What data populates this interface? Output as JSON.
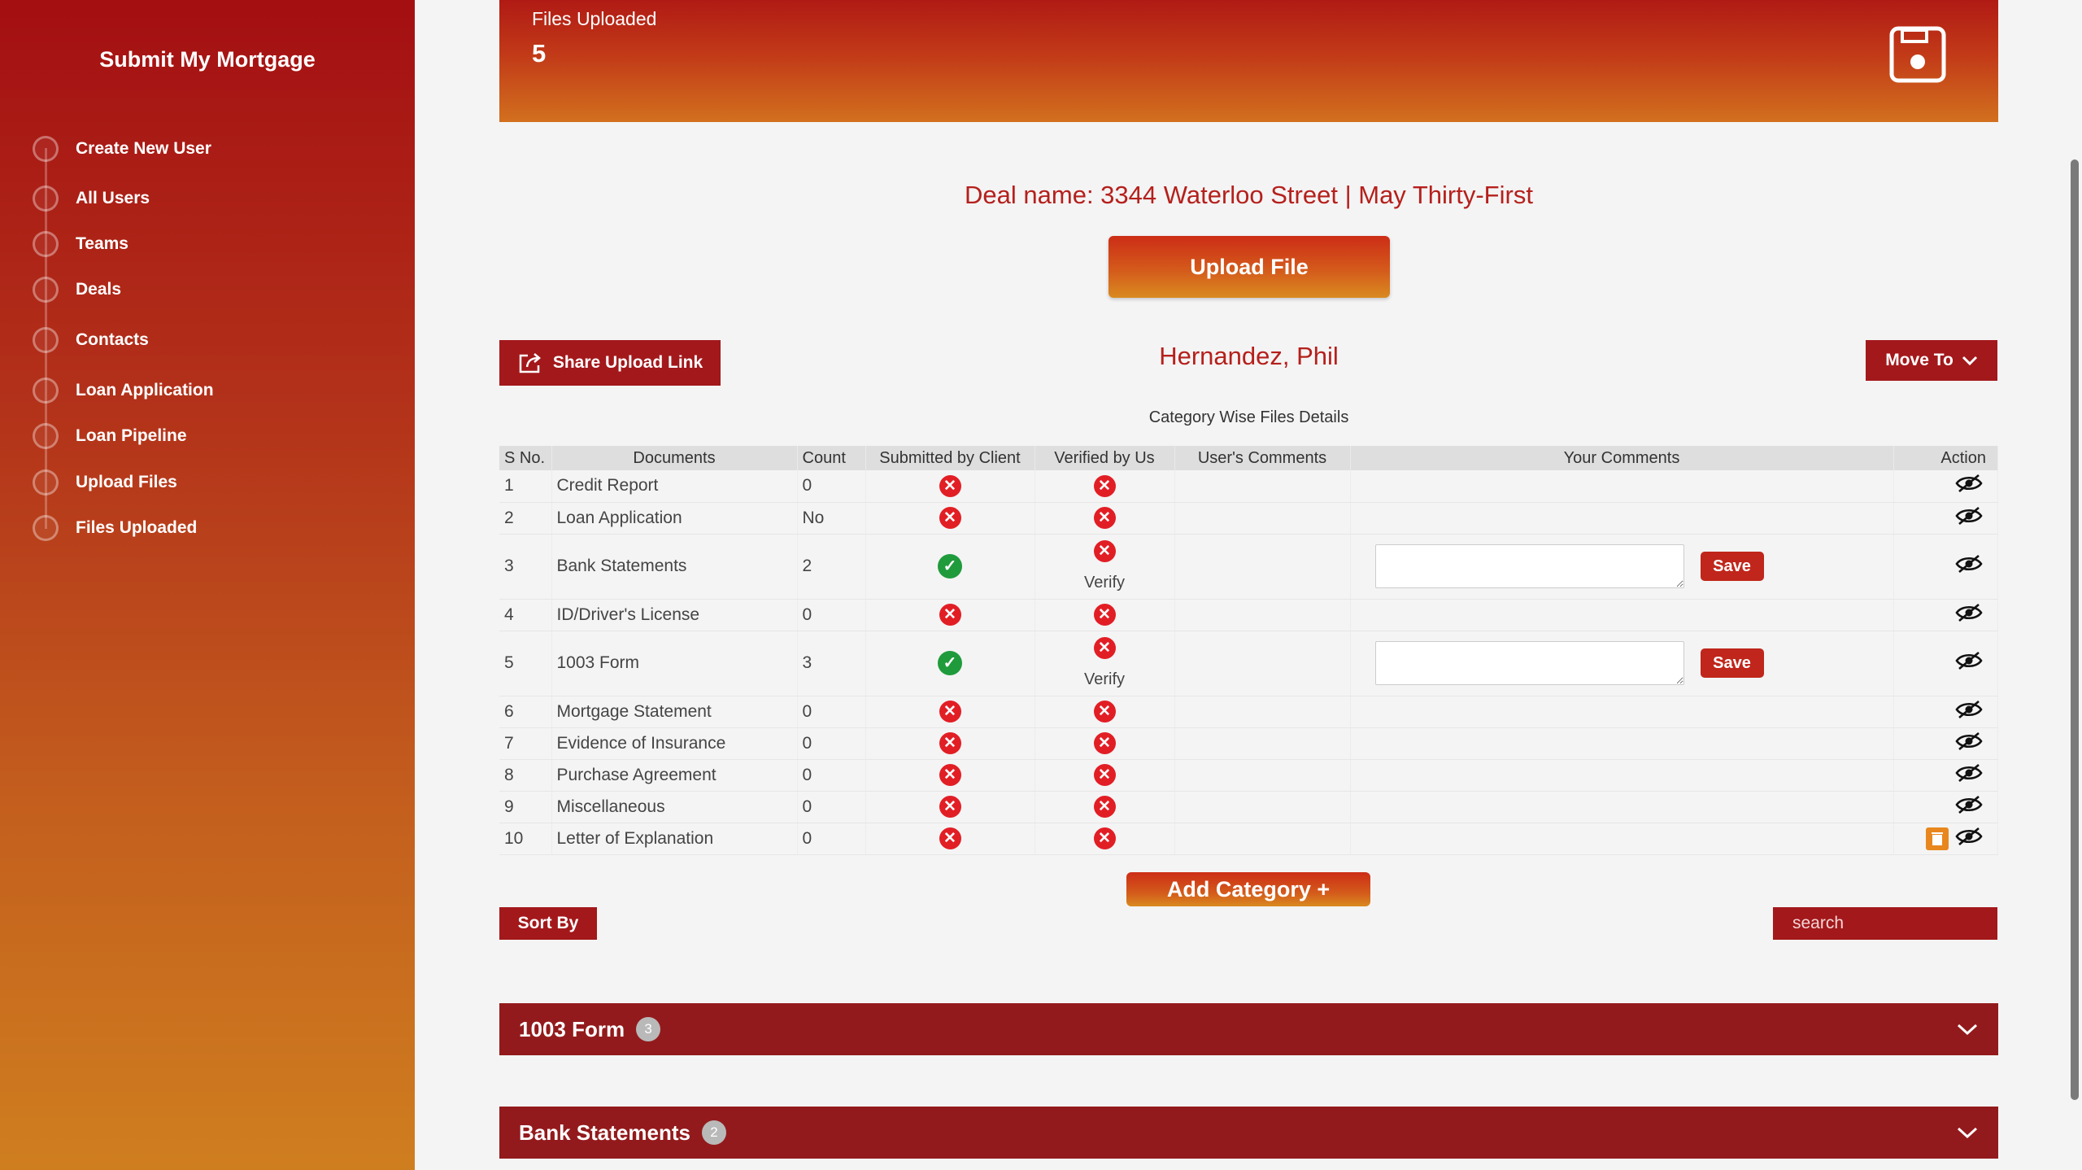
{
  "app": {
    "brand": "Submit My Mortgage"
  },
  "sidebar": {
    "items": [
      {
        "label": "Create New User"
      },
      {
        "label": "All Users"
      },
      {
        "label": "Teams"
      },
      {
        "label": "Deals"
      },
      {
        "label": "Contacts"
      },
      {
        "label": "Loan Application"
      },
      {
        "label": "Loan Pipeline"
      },
      {
        "label": "Upload Files"
      },
      {
        "label": "Files Uploaded"
      }
    ]
  },
  "header": {
    "label": "Files Uploaded",
    "count": "5",
    "icon": "save-icon"
  },
  "deal": {
    "name": "Deal name: 3344 Waterloo Street | May Thirty-First"
  },
  "actions": {
    "upload_label": "Upload File",
    "share_label": "Share Upload Link",
    "move_to_label": "Move To",
    "add_category_label": "Add Category +",
    "sort_by_label": "Sort By",
    "search_placeholder": "search"
  },
  "client": {
    "name": "Hernandez, Phil"
  },
  "table": {
    "caption": "Category Wise Files Details",
    "columns": [
      "S No.",
      "Documents",
      "Count",
      "Submitted by Client",
      "Verified by Us",
      "User's Comments",
      "Your Comments",
      "Action"
    ],
    "rows": [
      {
        "sno": "1",
        "document": "Credit Report",
        "count": "0",
        "submitted": false,
        "verified": false
      },
      {
        "sno": "2",
        "document": "Loan Application",
        "count": "No",
        "submitted": false,
        "verified": false
      },
      {
        "sno": "3",
        "document": "Bank Statements",
        "count": "2",
        "submitted": true,
        "verified": false,
        "verify_label": "Verify",
        "save_label": "Save"
      },
      {
        "sno": "4",
        "document": "ID/Driver's License",
        "count": "0",
        "submitted": false,
        "verified": false
      },
      {
        "sno": "5",
        "document": "1003 Form",
        "count": "3",
        "submitted": true,
        "verified": false,
        "verify_label": "Verify",
        "save_label": "Save"
      },
      {
        "sno": "6",
        "document": "Mortgage Statement",
        "count": "0",
        "submitted": false,
        "verified": false
      },
      {
        "sno": "7",
        "document": "Evidence of Insurance",
        "count": "0",
        "submitted": false,
        "verified": false
      },
      {
        "sno": "8",
        "document": "Purchase Agreement",
        "count": "0",
        "submitted": false,
        "verified": false
      },
      {
        "sno": "9",
        "document": "Miscellaneous",
        "count": "0",
        "submitted": false,
        "verified": false
      },
      {
        "sno": "10",
        "document": "Letter of Explanation",
        "count": "0",
        "submitted": false,
        "verified": false,
        "deletable": true
      }
    ]
  },
  "sections": [
    {
      "title": "1003 Form",
      "badge": "3"
    },
    {
      "title": "Bank Statements",
      "badge": "2"
    }
  ],
  "colors": {
    "primary": "#a3181b",
    "accent": "#d45a1b",
    "error": "#e21e25",
    "success": "#1f9b3c"
  }
}
